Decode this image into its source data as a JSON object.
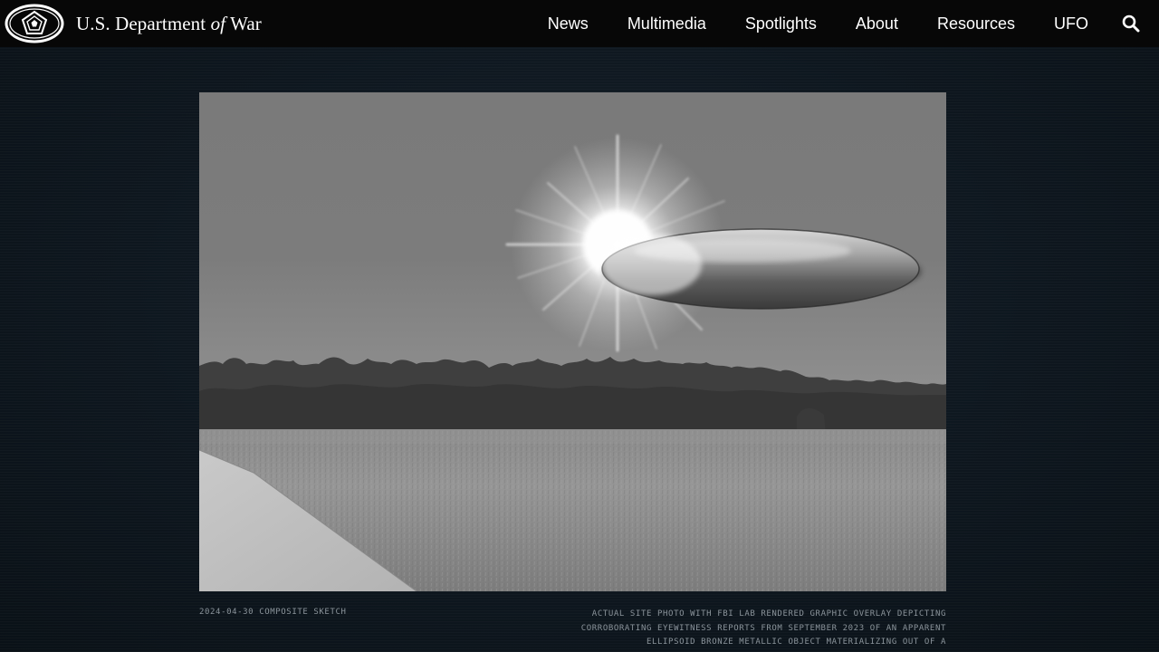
{
  "header": {
    "site_name_prefix": "U.S. Department ",
    "site_name_italic": "of",
    "site_name_suffix": " War",
    "logo_icon": "pentagon-seal-icon",
    "nav": [
      {
        "label": "News"
      },
      {
        "label": "Multimedia"
      },
      {
        "label": "Spotlights"
      },
      {
        "label": "About"
      },
      {
        "label": "Resources"
      },
      {
        "label": "UFO"
      }
    ],
    "search_icon": "search-icon"
  },
  "figure": {
    "caption_date_label": "2024-04-30 COMPOSITE SKETCH",
    "caption_description": "ACTUAL SITE PHOTO WITH FBI LAB RENDERED GRAPHIC OVERLAY DEPICTING CORROBORATING EYEWITNESS REPORTS FROM SEPTEMBER 2023 OF AN APPARENT ELLIPSOID BRONZE METALLIC OBJECT MATERIALIZING OUT OF A"
  },
  "colors": {
    "header_bg": "#070707",
    "page_bg": "#0e171f",
    "caption_text": "#8b949b"
  }
}
